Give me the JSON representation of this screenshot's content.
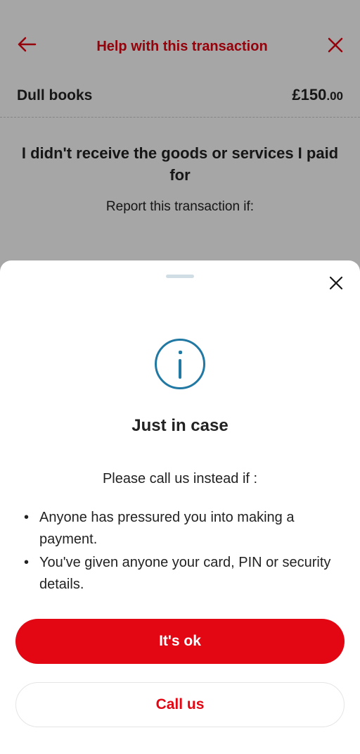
{
  "header": {
    "title": "Help with this transaction"
  },
  "transaction": {
    "merchant": "Dull books",
    "currency_symbol": "£",
    "amount_major": "150",
    "amount_minor": ".00"
  },
  "issue": {
    "title": "I didn't receive the goods or services I paid for",
    "subtitle": "Report this transaction if:"
  },
  "sheet": {
    "title": "Just in case",
    "subtitle": "Please call us instead if :",
    "bullets": [
      "Anyone has pressured you into making a payment.",
      "You've given anyone your card, PIN or security details."
    ],
    "primary_button": "It's ok",
    "secondary_button": "Call us"
  }
}
